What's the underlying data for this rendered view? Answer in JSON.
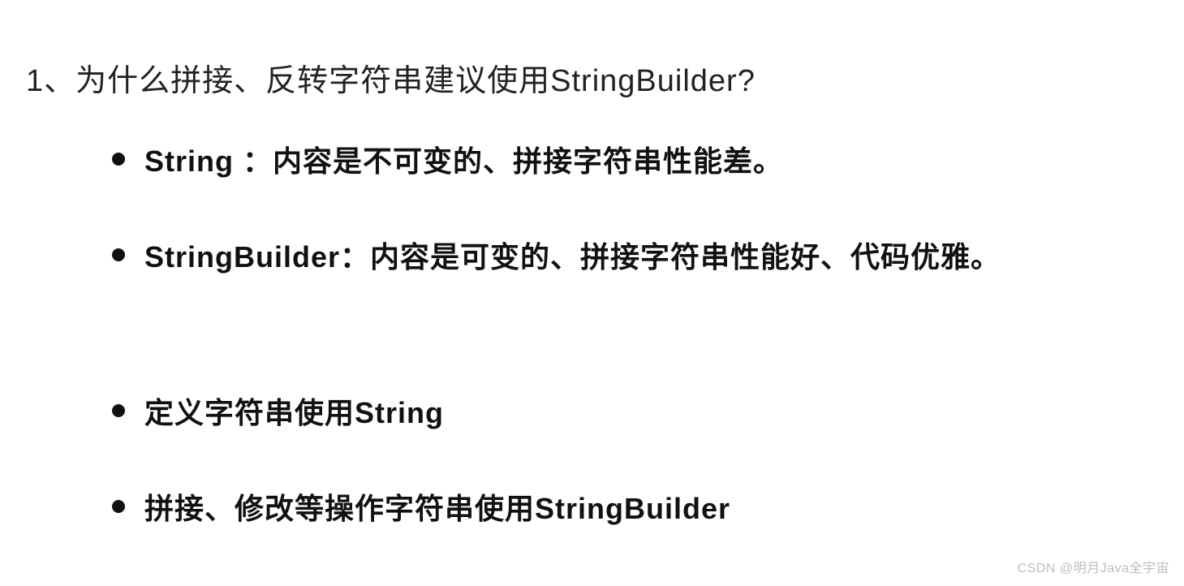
{
  "heading": "1、为什么拼接、反转字符串建议使用StringBuilder?",
  "section1": {
    "items": [
      "String ：内容是不可变的、拼接字符串性能差。",
      "StringBuilder：内容是可变的、拼接字符串性能好、代码优雅。"
    ]
  },
  "section2": {
    "items": [
      "定义字符串使用String",
      "拼接、修改等操作字符串使用StringBuilder"
    ]
  },
  "watermark": "CSDN @明月Java全宇宙"
}
